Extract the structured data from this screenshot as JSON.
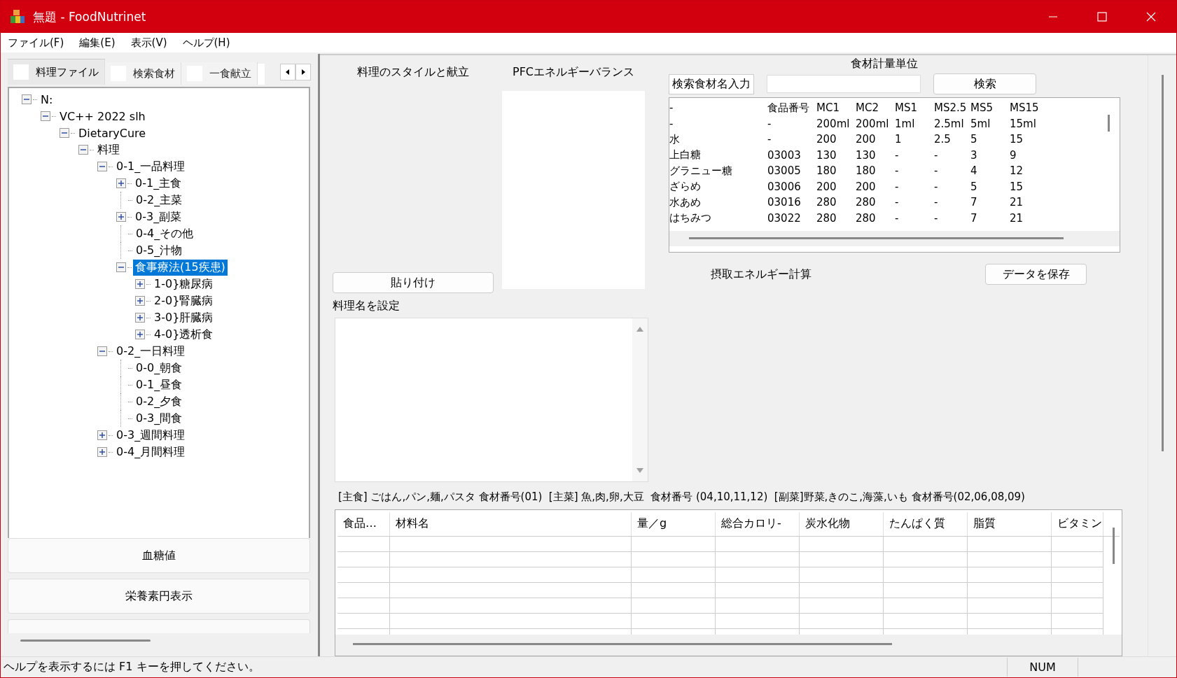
{
  "window": {
    "title": "無題 - FoodNutrinet"
  },
  "menu": [
    "ファイル(F)",
    "編集(E)",
    "表示(V)",
    "ヘルプ(H)"
  ],
  "tabs": [
    {
      "label": "料理ファイル",
      "selected": true
    },
    {
      "label": "検索食材",
      "selected": false
    },
    {
      "label": "一食献立",
      "selected": false
    }
  ],
  "tree": [
    {
      "label": "N:",
      "expanded": true,
      "selected": false,
      "children": [
        {
          "label": "VC++ 2022 slh",
          "expanded": true,
          "selected": false,
          "children": [
            {
              "label": "DietaryCure",
              "expanded": true,
              "selected": false,
              "children": [
                {
                  "label": "料理",
                  "expanded": true,
                  "selected": false,
                  "children": [
                    {
                      "label": "0-1_一品料理",
                      "expanded": true,
                      "selected": false,
                      "children": [
                        {
                          "label": "0-1_主食",
                          "expanded": false,
                          "selected": false
                        },
                        {
                          "label": "0-2_主菜",
                          "selected": false
                        },
                        {
                          "label": "0-3_副菜",
                          "expanded": false,
                          "selected": false
                        },
                        {
                          "label": "0-4_その他",
                          "selected": false
                        },
                        {
                          "label": "0-5_汁物",
                          "selected": false
                        },
                        {
                          "label": "食事療法(15疾患)",
                          "expanded": true,
                          "selected": true,
                          "children": [
                            {
                              "label": "1-0}糖尿病",
                              "expanded": false,
                              "selected": false
                            },
                            {
                              "label": "2-0}腎臓病",
                              "expanded": false,
                              "selected": false
                            },
                            {
                              "label": "3-0}肝臓病",
                              "expanded": false,
                              "selected": false
                            },
                            {
                              "label": "4-0}透析食",
                              "expanded": false,
                              "selected": false
                            }
                          ]
                        }
                      ]
                    },
                    {
                      "label": "0-2_一日料理",
                      "expanded": true,
                      "selected": false,
                      "children": [
                        {
                          "label": "0-0_朝食",
                          "selected": false
                        },
                        {
                          "label": "0-1_昼食",
                          "selected": false
                        },
                        {
                          "label": "0-2_夕食",
                          "selected": false
                        },
                        {
                          "label": "0-3_間食",
                          "selected": false
                        }
                      ]
                    },
                    {
                      "label": "0-3_週間料理",
                      "expanded": false,
                      "selected": false
                    },
                    {
                      "label": "0-4_月間料理",
                      "expanded": false,
                      "selected": false
                    }
                  ]
                }
              ]
            }
          ]
        }
      ]
    }
  ],
  "left_buttons": [
    "血糖値",
    "栄養素円表示"
  ],
  "style_label": "料理のスタイルと献立",
  "pfc_label": "PFCエネルギーバランス",
  "unit_label": "食材計量単位",
  "search_label": "検索食材名入力",
  "search_button": "検索",
  "unit_rows": [
    [
      "-",
      "食品番号",
      "MC1",
      "MC2",
      "MS1",
      "MS2.5",
      "MS5",
      "MS15"
    ],
    [
      "-",
      "-",
      "200ml",
      "200ml",
      "1ml",
      "2.5ml",
      "5ml",
      "15ml"
    ],
    [
      "水",
      "-",
      "200",
      "200",
      "1",
      "2.5",
      "5",
      "15"
    ],
    [
      "上白糖",
      "03003",
      "130",
      "130",
      "-",
      "-",
      "3",
      "9"
    ],
    [
      "グラニュー糖",
      "03005",
      "180",
      "180",
      "-",
      "-",
      "4",
      "12"
    ],
    [
      "ざらめ",
      "03006",
      "200",
      "200",
      "-",
      "-",
      "5",
      "15"
    ],
    [
      "水あめ",
      "03016",
      "280",
      "280",
      "-",
      "-",
      "7",
      "21"
    ],
    [
      "はちみつ",
      "03022",
      "280",
      "280",
      "-",
      "-",
      "7",
      "21"
    ]
  ],
  "paste_button": "貼り付け",
  "energy_label": "摂取エネルギー計算",
  "save_button": "データを保存",
  "dish_name_label": "料理名を設定",
  "info_line": "[主食] ごはん,パン,麺,パスタ 食材番号(01)  [主菜] 魚,肉,卵,大豆  食材番号 (04,10,11,12)  [副菜]野菜,きのこ,海藻,いも 食材番号(02,06,08,09)",
  "grid_columns": [
    "食品…",
    "材料名",
    "量／g",
    "総合カロリ-",
    "炭水化物",
    "たんぱく質",
    "脂質",
    "ビタミン"
  ],
  "status_bar": {
    "message": "ヘルプを表示するには F1 キーを押してください。",
    "indicator": "NUM"
  }
}
